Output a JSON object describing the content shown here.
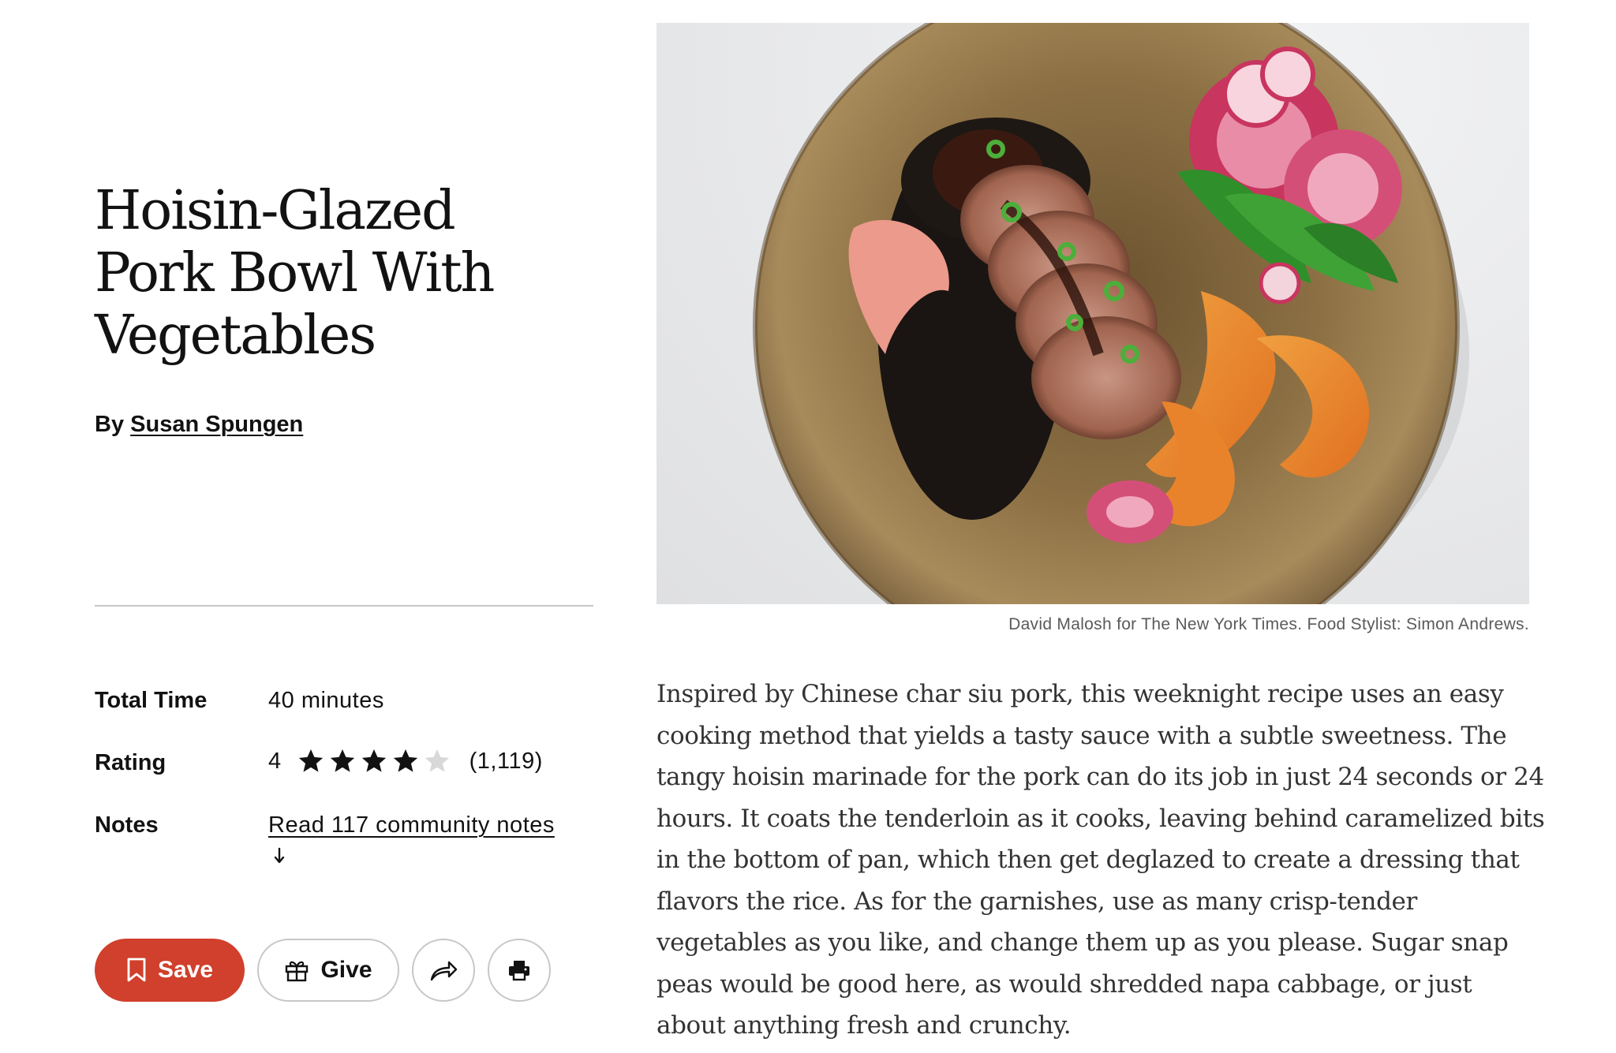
{
  "recipe": {
    "title": "Hoisin-Glazed Pork Bowl With Vegetables",
    "byline_prefix": "By",
    "author": "Susan Spungen"
  },
  "meta": {
    "total_time_label": "Total Time",
    "total_time_value": "40 minutes",
    "rating_label": "Rating",
    "rating_value": "4",
    "rating_stars": 4,
    "rating_max": 5,
    "rating_count": "(1,119)",
    "notes_label": "Notes",
    "notes_link": "Read 117 community notes"
  },
  "actions": {
    "save_label": "Save",
    "give_label": "Give",
    "save_icon": "bookmark-icon",
    "give_icon": "gift-icon",
    "share_icon": "share-arrow-icon",
    "print_icon": "printer-icon"
  },
  "photo": {
    "credit": "David Malosh for The New York Times. Food Stylist: Simon Andrews."
  },
  "description": "Inspired by Chinese char siu pork, this weeknight recipe uses an easy cooking method that yields a tasty sauce with a subtle sweetness. The tangy hoisin marinade for the pork can do its job in just 24 seconds or 24 hours. It coats the tenderloin as it cooks, leaving behind caramelized bits in the bottom of pan, which then get deglazed to create a dressing that flavors the rice. As for the garnishes, use as many crisp-tender vegetables as you like, and change them up as you please. Sugar snap peas would be good here, as would shredded napa cabbage, or just about anything fresh and crunchy.",
  "colors": {
    "save_button": "#d0402c",
    "text": "#121212",
    "divider": "#c7c7c7",
    "star_filled": "#121212",
    "star_empty": "#d8d8d8"
  }
}
